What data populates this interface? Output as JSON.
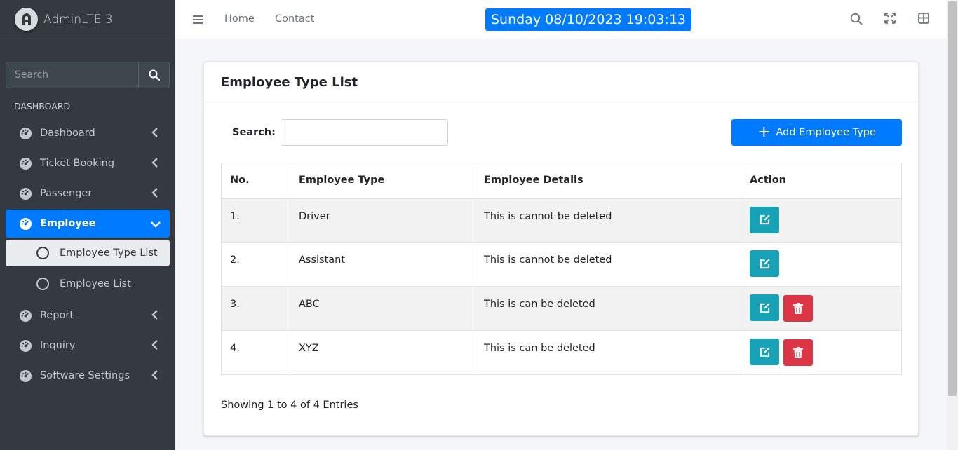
{
  "brand": {
    "title": "AdminLTE 3"
  },
  "sidebar": {
    "search_placeholder": "Search",
    "header": "DASHBOARD",
    "items": [
      {
        "label": "Dashboard",
        "icon": "tachometer-icon"
      },
      {
        "label": "Ticket Booking",
        "icon": "tachometer-icon"
      },
      {
        "label": "Passenger",
        "icon": "tachometer-icon"
      },
      {
        "label": "Employee",
        "icon": "tachometer-icon",
        "active": true
      },
      {
        "label": "Report",
        "icon": "tachometer-icon"
      },
      {
        "label": "Inquiry",
        "icon": "tachometer-icon"
      },
      {
        "label": "Software Settings",
        "icon": "tachometer-icon"
      }
    ],
    "sub_items": [
      {
        "label": "Employee Type List",
        "active": true
      },
      {
        "label": "Employee List"
      }
    ]
  },
  "topbar": {
    "links": [
      "Home",
      "Contact"
    ],
    "datetime": "Sunday 08/10/2023 19:03:13"
  },
  "card": {
    "title": "Employee Type List",
    "search_label": "Search:",
    "search_value": "",
    "add_button": "Add Employee Type",
    "table": {
      "headers": [
        "No.",
        "Employee Type",
        "Employee Details",
        "Action"
      ],
      "rows": [
        {
          "no": "1.",
          "type": "Driver",
          "details": "This is cannot be deleted",
          "deletable": false
        },
        {
          "no": "2.",
          "type": "Assistant",
          "details": "This is cannot be deleted",
          "deletable": false
        },
        {
          "no": "3.",
          "type": "ABC",
          "details": "This is can be deleted",
          "deletable": true
        },
        {
          "no": "4.",
          "type": "XYZ",
          "details": "This is can be deleted",
          "deletable": true
        }
      ]
    },
    "info": "Showing 1 to 4 of 4 Entries"
  },
  "colors": {
    "primary": "#007bff",
    "sidebar_bg": "#343a40",
    "edit": "#17a2b8",
    "delete": "#dc3545"
  }
}
